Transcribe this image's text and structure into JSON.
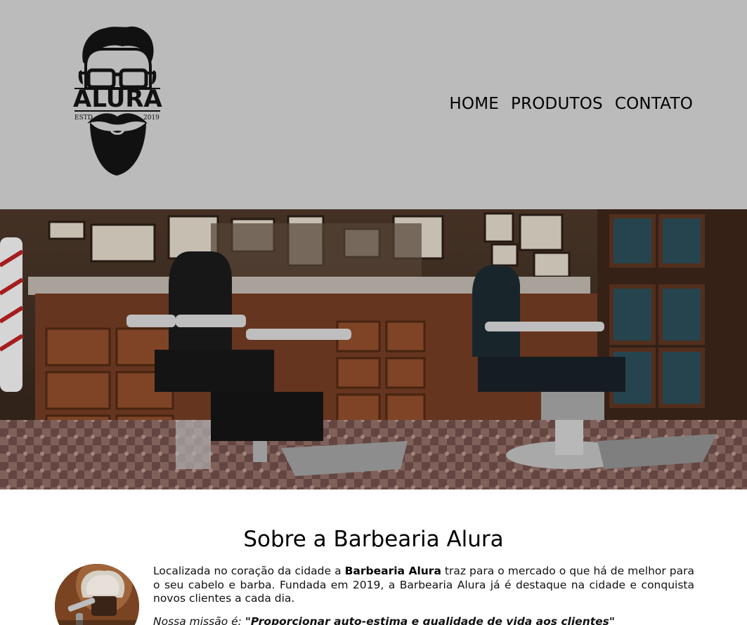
{
  "header": {
    "logo": {
      "brand": "ALURA",
      "estd": "ESTD",
      "year": "2019"
    },
    "nav": [
      {
        "label": "HOME"
      },
      {
        "label": "PRODUTOS"
      },
      {
        "label": "CONTATO"
      }
    ],
    "background_color": "#bbbbbb"
  },
  "banner": {
    "image": "barbershop-interior-with-two-barber-chairs"
  },
  "about": {
    "title": "Sobre a Barbearia Alura",
    "photo": "shaving-brush-and-razor",
    "paragraph_before": "Localizada no coração da cidade a ",
    "paragraph_strong": "Barbearia Alura",
    "paragraph_after": " traz para o mercado o que há de melhor para o seu cabelo e barba. Fundada em 2019, a Barbearia Alura já é destaque na cidade e conquista novos clientes a cada dia.",
    "mission_label": "Nossa missão é: ",
    "mission_text": "\"Proporcionar auto-estima e qualidade de vida aos clientes\""
  }
}
